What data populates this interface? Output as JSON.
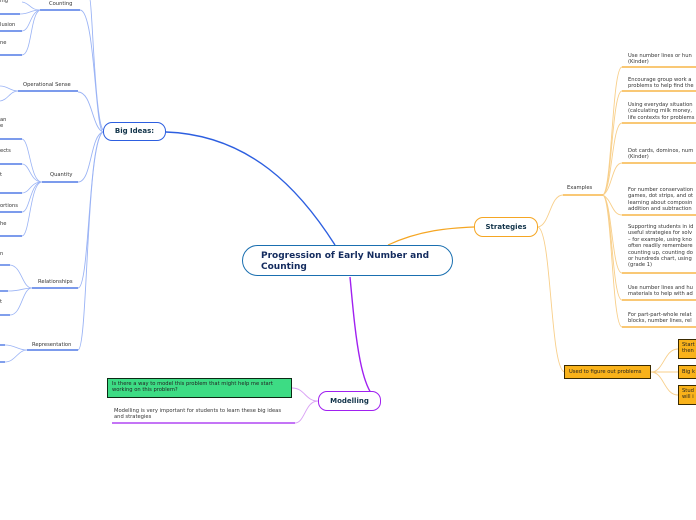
{
  "central": {
    "title": "Progression of Early Number and Counting"
  },
  "colors": {
    "big_ideas": "#2d5fe0",
    "big_ideas_light": "#9ab3f5",
    "strategies": "#f5a623",
    "strategies_light": "#f8cf8a",
    "modelling": "#a020f0",
    "modelling_light": "#d9a0f5",
    "green_box": "#3ddc84",
    "orange_box": "#f9b21a"
  },
  "big_ideas": {
    "label": "Big Ideas:",
    "branches": [
      {
        "label": "Counting",
        "children": [
          "...ing",
          "...lusion",
          "...ne"
        ]
      },
      {
        "label": "Operational Sense",
        "children": [
          "",
          ""
        ]
      },
      {
        "label": "Quantity",
        "children": [
          "...an ...e",
          "...ects",
          "...t",
          "",
          "...ortions",
          "...he"
        ]
      },
      {
        "label": "Relationships",
        "children": [
          "...n",
          "",
          "...t"
        ]
      },
      {
        "label": "Representation",
        "children": [
          "",
          ""
        ]
      }
    ]
  },
  "strategies": {
    "label": "Strategies",
    "examples": {
      "label": "Examples",
      "items": [
        "Use number lines or hun... (Kinder)",
        "Encourage group work a... problems to help find the...",
        "Using everyday situation... (calculating milk money,... life contexts for problems...",
        "Dot cards, dominos, num... (Kinder)",
        "For number conservation... games, dot strips, and ot... learning about composin... addition and subtraction...",
        "Supporting students in id... useful strategies for solv... – for example, using kno... often readily remembere... counting up, counting do... or hundreds chart, using... (grade 1)",
        "Use number lines and hu... materials to help with ad...",
        "For part-part-whole relat... blocks, number lines, rel..."
      ]
    },
    "used_to": {
      "label": "Used to figure out problems",
      "items": [
        "Start... then...",
        "Big k...",
        "Stud... will i..."
      ]
    }
  },
  "modelling": {
    "label": "Modelling",
    "items": [
      "Is there a way to model this problem that might help me start working on this problem?",
      "Modelling is very important for students to learn these big ideas and strategies"
    ]
  }
}
